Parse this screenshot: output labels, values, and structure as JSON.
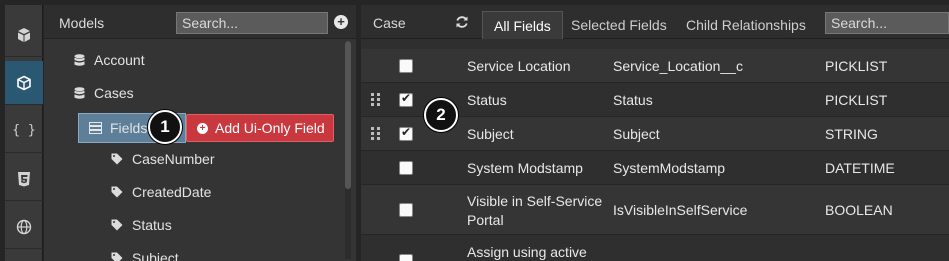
{
  "rail": {
    "items": [
      {
        "name": "objects-icon"
      },
      {
        "name": "cube-icon",
        "active": true
      },
      {
        "name": "braces-icon",
        "text": "{ }"
      },
      {
        "name": "css3-icon"
      },
      {
        "name": "globe-icon"
      }
    ]
  },
  "tree": {
    "title": "Models",
    "search_placeholder": "Search...",
    "nodes": {
      "account": "Account",
      "cases": "Cases",
      "fields": "Fields",
      "case_number": "CaseNumber",
      "created_date": "CreatedDate",
      "status": "Status",
      "subject_partial": "Subject"
    },
    "add_button": "Add Ui-Only Field",
    "callout": "1"
  },
  "fields_panel": {
    "object": "Case",
    "tabs": [
      "All Fields",
      "Selected Fields",
      "Child Relationships"
    ],
    "active_tab": "All Fields",
    "search_placeholder": "Search...",
    "callout": "2",
    "rows": [
      {
        "label": "Service Location",
        "api": "Service_Location__c",
        "type": "PICKLIST",
        "checked": false,
        "draggable": false
      },
      {
        "label": "Status",
        "api": "Status",
        "type": "PICKLIST",
        "checked": true,
        "draggable": true
      },
      {
        "label": "Subject",
        "api": "Subject",
        "type": "STRING",
        "checked": true,
        "draggable": true
      },
      {
        "label": "System Modstamp",
        "api": "SystemModstamp",
        "type": "DATETIME",
        "checked": false,
        "draggable": false
      },
      {
        "label": "Visible in Self-Service",
        "label2": "Portal",
        "api": "IsVisibleInSelfService",
        "type": "BOOLEAN",
        "checked": false,
        "draggable": false
      },
      {
        "label": "Assign using active",
        "api": "",
        "type": "",
        "checked": false,
        "draggable": false
      }
    ]
  }
}
